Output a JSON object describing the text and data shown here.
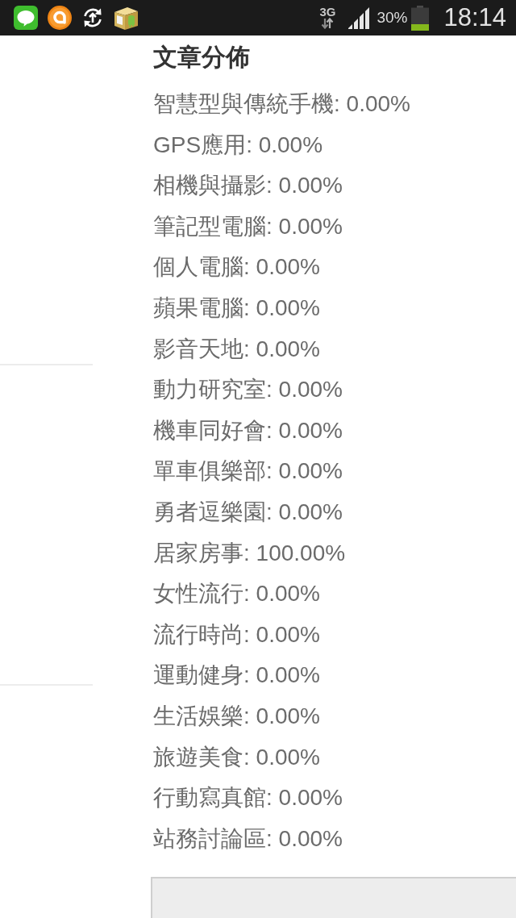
{
  "status_bar": {
    "network": "3G",
    "battery": "30%",
    "time": "18:14"
  },
  "article_distribution": {
    "title": "文章分佈",
    "rows": [
      "智慧型與傳統手機: 0.00%",
      "GPS應用: 0.00%",
      "相機與攝影: 0.00%",
      "筆記型電腦: 0.00%",
      "個人電腦: 0.00%",
      "蘋果電腦: 0.00%",
      "影音天地: 0.00%",
      "動力研究室: 0.00%",
      "機車同好會: 0.00%",
      "單車俱樂部: 0.00%",
      "勇者逗樂園: 0.00%",
      "居家房事: 100.00%",
      "女性流行: 0.00%",
      "流行時尚: 0.00%",
      "運動健身: 0.00%",
      "生活娛樂: 0.00%",
      "旅遊美食: 0.00%",
      "行動寫真館: 0.00%",
      "站務討論區: 0.00%"
    ]
  }
}
